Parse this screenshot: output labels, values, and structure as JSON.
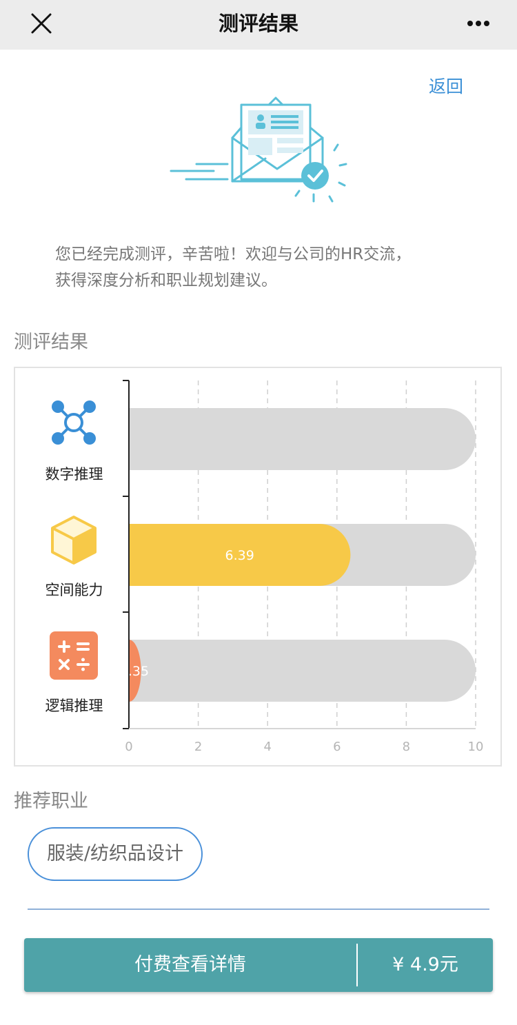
{
  "nav": {
    "title": "测评结果"
  },
  "back_label": "返回",
  "intro": {
    "line1": "您已经完成测评，辛苦啦！欢迎与公司的HR交流，",
    "line2": "获得深度分析和职业规划建议。"
  },
  "results_section_title": "测评结果",
  "chart_data": {
    "type": "bar",
    "orientation": "horizontal",
    "categories": [
      "数字推理",
      "空间能力",
      "逻辑推理"
    ],
    "values": [
      0,
      6.39,
      0.35
    ],
    "value_labels": [
      "",
      "6.39",
      ".35"
    ],
    "xlim": [
      0,
      10
    ],
    "x_ticks": [
      "0",
      "2",
      "4",
      "6",
      "8",
      "10"
    ],
    "grid": "vertical dashed",
    "colors": {
      "track": "#d9d9d9",
      "空间能力": "#f7c948",
      "逻辑推理": "#f48a5e"
    },
    "icons": [
      "network-icon",
      "cube-icon",
      "calculator-icon"
    ]
  },
  "career_section_title": "推荐职业",
  "career_tag": "服装/纺织品设计",
  "pay": {
    "label": "付费查看详情",
    "price": "¥ 4.9元"
  },
  "colors": {
    "accent": "#3a8fd6",
    "pay_button": "#4fa3a8"
  }
}
